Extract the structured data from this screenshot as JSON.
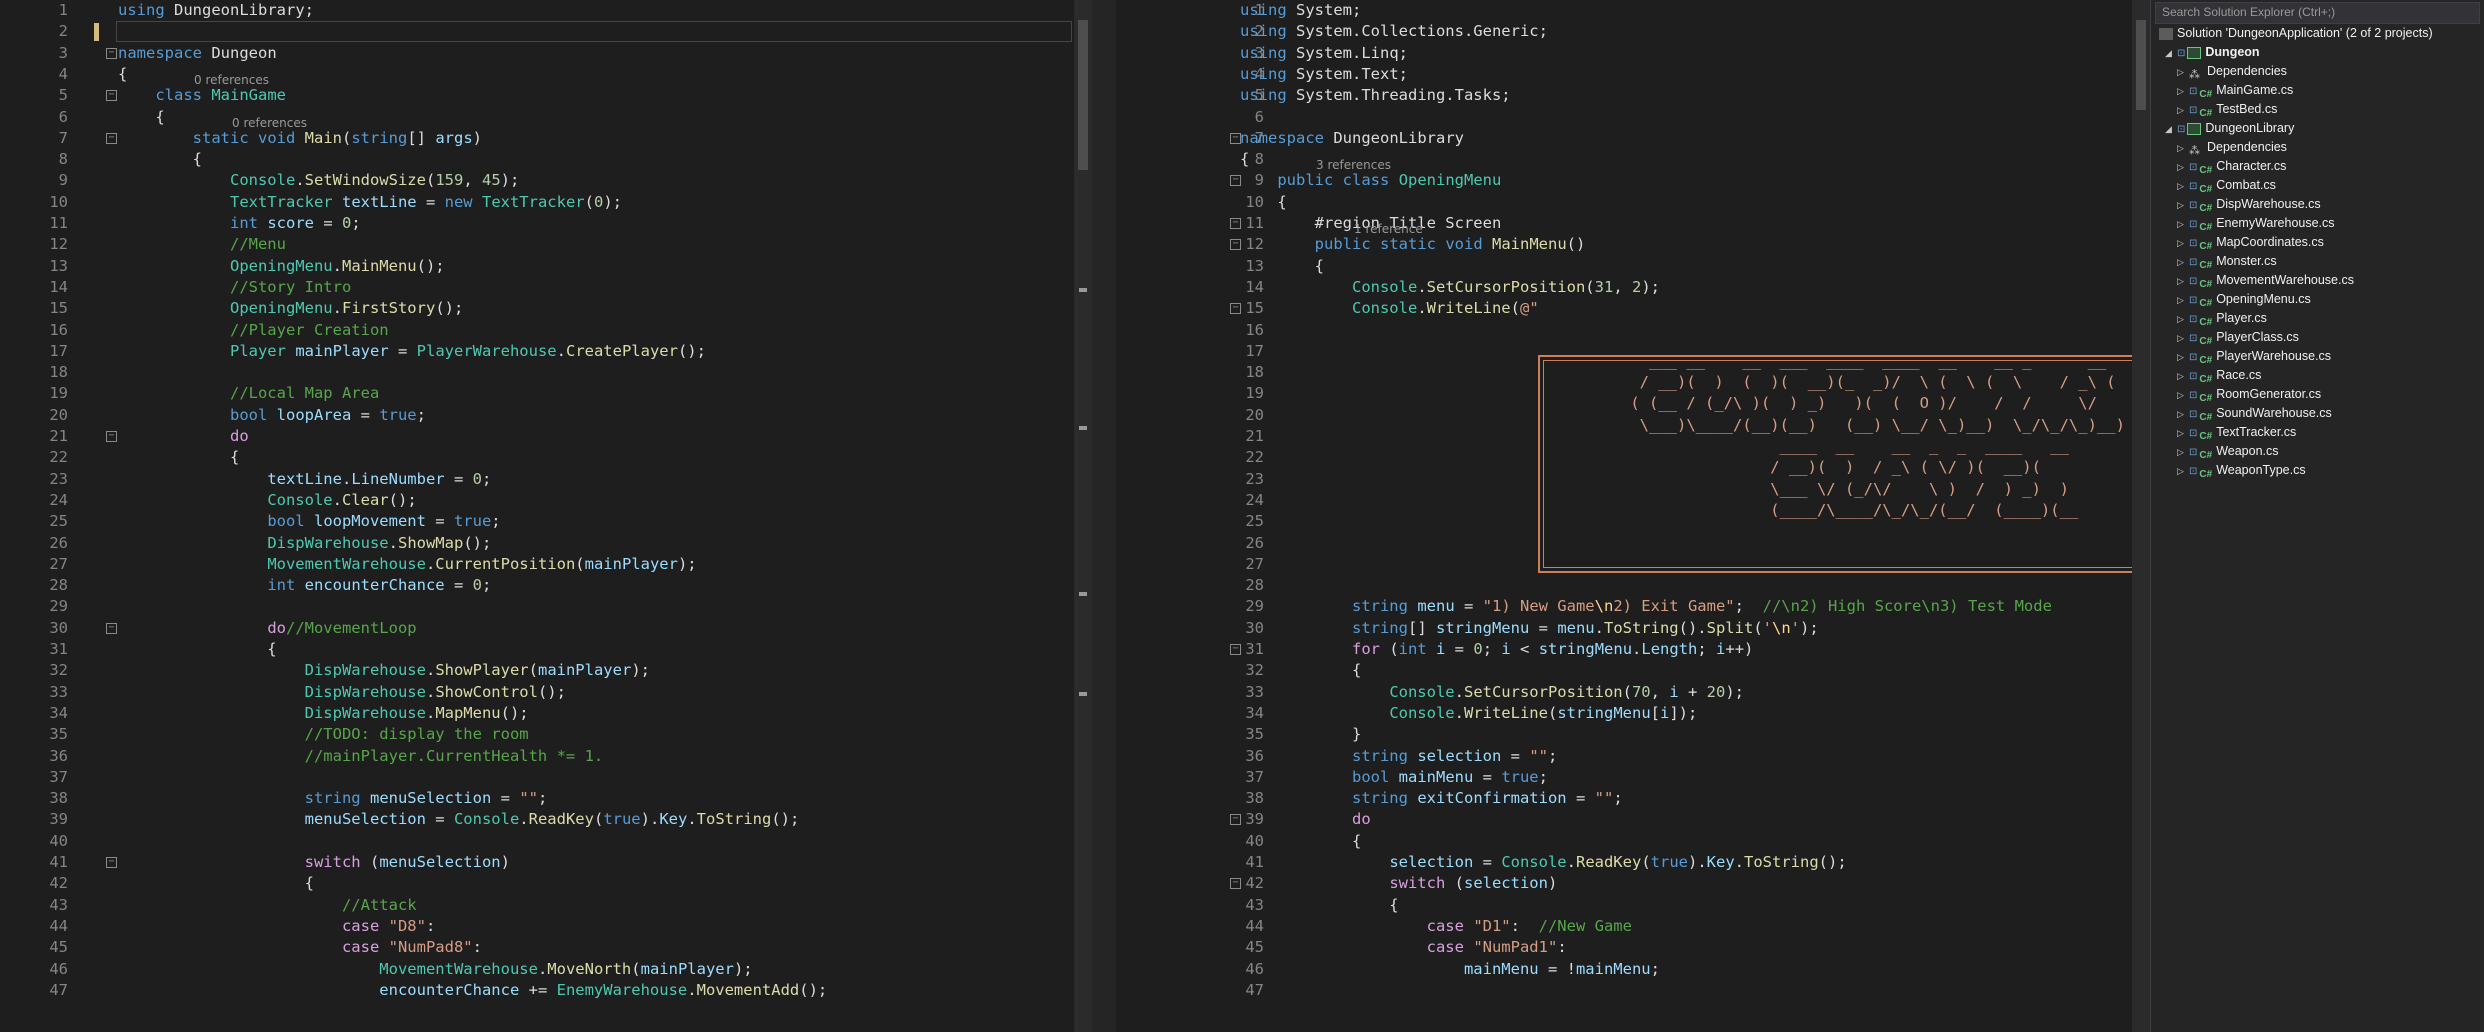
{
  "left_editor": {
    "lines": [
      {
        "n": 1,
        "html": "<span class=\"kw\">using</span> DungeonLibrary;"
      },
      {
        "n": 2,
        "html": ""
      },
      {
        "n": 3,
        "html": "<span class=\"kw\">namespace</span> Dungeon",
        "fold": true
      },
      {
        "n": 4,
        "html": "{"
      },
      {
        "n": 5,
        "html": "    <span class=\"kw\">class</span> <span class=\"ty\">MainGame</span>",
        "fold": true,
        "refs": "0 references"
      },
      {
        "n": 6,
        "html": "    {"
      },
      {
        "n": 7,
        "html": "        <span class=\"kw\">static</span> <span class=\"kw\">void</span> <span class=\"me\">Main</span>(<span class=\"kw\">string</span>[] <span class=\"va\">args</span>)",
        "fold": true,
        "refs": "0 references"
      },
      {
        "n": 8,
        "html": "        {"
      },
      {
        "n": 9,
        "html": "            <span class=\"ty\">Console</span>.<span class=\"me\">SetWindowSize</span>(<span class=\"nu\">159</span>, <span class=\"nu\">45</span>);"
      },
      {
        "n": 10,
        "html": "            <span class=\"ty\">TextTracker</span> <span class=\"va\">textLine</span> = <span class=\"kw\">new</span> <span class=\"ty\">TextTracker</span>(<span class=\"nu\">0</span>);"
      },
      {
        "n": 11,
        "html": "            <span class=\"kw\">int</span> <span class=\"va\">score</span> = <span class=\"nu\">0</span>;"
      },
      {
        "n": 12,
        "html": "            <span class=\"cm\">//Menu</span>"
      },
      {
        "n": 13,
        "html": "            <span class=\"ty\">OpeningMenu</span>.<span class=\"me\">MainMenu</span>();"
      },
      {
        "n": 14,
        "html": "            <span class=\"cm\">//Story Intro</span>"
      },
      {
        "n": 15,
        "html": "            <span class=\"ty\">OpeningMenu</span>.<span class=\"me\">FirstStory</span>();"
      },
      {
        "n": 16,
        "html": "            <span class=\"cm\">//Player Creation</span>"
      },
      {
        "n": 17,
        "html": "            <span class=\"ty\">Player</span> <span class=\"va\">mainPlayer</span> = <span class=\"ty\">PlayerWarehouse</span>.<span class=\"me\">CreatePlayer</span>();"
      },
      {
        "n": 18,
        "html": ""
      },
      {
        "n": 19,
        "html": "            <span class=\"cm\">//Local Map Area</span>"
      },
      {
        "n": 20,
        "html": "            <span class=\"kw\">bool</span> <span class=\"va\">loopArea</span> = <span class=\"kw\">true</span>;"
      },
      {
        "n": 21,
        "html": "            <span class=\"ctl\">do</span>",
        "fold": true
      },
      {
        "n": 22,
        "html": "            {"
      },
      {
        "n": 23,
        "html": "                <span class=\"va\">textLine</span>.<span class=\"va\">LineNumber</span> = <span class=\"nu\">0</span>;"
      },
      {
        "n": 24,
        "html": "                <span class=\"ty\">Console</span>.<span class=\"me\">Clear</span>();"
      },
      {
        "n": 25,
        "html": "                <span class=\"kw\">bool</span> <span class=\"va\">loopMovement</span> = <span class=\"kw\">true</span>;"
      },
      {
        "n": 26,
        "html": "                <span class=\"ty\">DispWarehouse</span>.<span class=\"me\">ShowMap</span>();"
      },
      {
        "n": 27,
        "html": "                <span class=\"ty\">MovementWarehouse</span>.<span class=\"me\">CurrentPosition</span>(<span class=\"va\">mainPlayer</span>);"
      },
      {
        "n": 28,
        "html": "                <span class=\"kw\">int</span> <span class=\"va\">encounterChance</span> = <span class=\"nu\">0</span>;"
      },
      {
        "n": 29,
        "html": ""
      },
      {
        "n": 30,
        "html": "                <span class=\"ctl\">do</span><span class=\"cm\">//MovementLoop</span>",
        "fold": true
      },
      {
        "n": 31,
        "html": "                {"
      },
      {
        "n": 32,
        "html": "                    <span class=\"ty\">DispWarehouse</span>.<span class=\"me\">ShowPlayer</span>(<span class=\"va\">mainPlayer</span>);"
      },
      {
        "n": 33,
        "html": "                    <span class=\"ty\">DispWarehouse</span>.<span class=\"me\">ShowControl</span>();"
      },
      {
        "n": 34,
        "html": "                    <span class=\"ty\">DispWarehouse</span>.<span class=\"me\">MapMenu</span>();"
      },
      {
        "n": 35,
        "html": "                    <span class=\"cm\">//TODO: display the room</span>"
      },
      {
        "n": 36,
        "html": "                    <span class=\"cm\">//mainPlayer.CurrentHealth *= 1.</span>"
      },
      {
        "n": 37,
        "html": ""
      },
      {
        "n": 38,
        "html": "                    <span class=\"kw\">string</span> <span class=\"va\">menuSelection</span> = <span class=\"st\">\"\"</span>;"
      },
      {
        "n": 39,
        "html": "                    <span class=\"va\">menuSelection</span> = <span class=\"ty\">Console</span>.<span class=\"me\">ReadKey</span>(<span class=\"kw\">true</span>).<span class=\"va\">Key</span>.<span class=\"me\">ToString</span>();"
      },
      {
        "n": 40,
        "html": ""
      },
      {
        "n": 41,
        "html": "                    <span class=\"ctl\">switch</span> (<span class=\"va\">menuSelection</span>)",
        "fold": true
      },
      {
        "n": 42,
        "html": "                    {"
      },
      {
        "n": 43,
        "html": "                        <span class=\"cm\">//Attack</span>"
      },
      {
        "n": 44,
        "html": "                        <span class=\"ctl\">case</span> <span class=\"st\">\"D8\"</span>:"
      },
      {
        "n": 45,
        "html": "                        <span class=\"ctl\">case</span> <span class=\"st\">\"NumPad8\"</span>:"
      },
      {
        "n": 46,
        "html": "                            <span class=\"ty\">MovementWarehouse</span>.<span class=\"me\">MoveNorth</span>(<span class=\"va\">mainPlayer</span>);"
      },
      {
        "n": 47,
        "html": "                            <span class=\"va\">encounterChance</span> += <span class=\"ty\">EnemyWarehouse</span>.<span class=\"me\">MovementAdd</span>();"
      }
    ]
  },
  "right_editor": {
    "lines": [
      {
        "n": 1,
        "html": "<span class=\"kw\">using</span> System;"
      },
      {
        "n": 2,
        "html": "<span class=\"kw\">using</span> System.Collections.Generic;"
      },
      {
        "n": 3,
        "html": "<span class=\"kw\">using</span> System.Linq;"
      },
      {
        "n": 4,
        "html": "<span class=\"kw\">using</span> System.Text;"
      },
      {
        "n": 5,
        "html": "<span class=\"kw\">using</span> System.Threading.Tasks;"
      },
      {
        "n": 6,
        "html": ""
      },
      {
        "n": 7,
        "html": "<span class=\"kw\">namespace</span> DungeonLibrary",
        "fold": true
      },
      {
        "n": 8,
        "html": "{"
      },
      {
        "n": 9,
        "html": "    <span class=\"kw\">public</span> <span class=\"kw\">class</span> <span class=\"ty\">OpeningMenu</span>",
        "fold": true,
        "refs": "3 references"
      },
      {
        "n": 10,
        "html": "    {"
      },
      {
        "n": 11,
        "html": "        <span class=\"rg\">#region</span> Title Screen",
        "fold": true
      },
      {
        "n": 12,
        "html": "        <span class=\"kw\">public</span> <span class=\"kw\">static</span> <span class=\"kw\">void</span> <span class=\"me\">MainMenu</span>()",
        "fold": true,
        "refs": "1 reference"
      },
      {
        "n": 13,
        "html": "        {"
      },
      {
        "n": 14,
        "html": "            <span class=\"ty\">Console</span>.<span class=\"me\">SetCursorPosition</span>(<span class=\"nu\">31</span>, <span class=\"nu\">2</span>);"
      },
      {
        "n": 15,
        "html": "            <span class=\"ty\">Console</span>.<span class=\"me\">WriteLine</span>(<span class=\"st\">@\"</span>",
        "fold": true
      },
      {
        "n": 16,
        "html": ""
      },
      {
        "n": 17,
        "html": ""
      },
      {
        "n": 18,
        "html": ""
      },
      {
        "n": 19,
        "html": ""
      },
      {
        "n": 20,
        "html": ""
      },
      {
        "n": 21,
        "html": ""
      },
      {
        "n": 22,
        "html": ""
      },
      {
        "n": 23,
        "html": ""
      },
      {
        "n": 24,
        "html": ""
      },
      {
        "n": 25,
        "html": ""
      },
      {
        "n": 26,
        "html": ""
      },
      {
        "n": 27,
        "html": ""
      },
      {
        "n": 28,
        "html": ""
      },
      {
        "n": 29,
        "html": "            <span class=\"kw\">string</span> <span class=\"va\">menu</span> = <span class=\"st\">\"1) New Game</span><span class=\"esc\">\\n</span><span class=\"st\">2) Exit Game\"</span>;  <span class=\"cm\">//\\n2) High Score\\n3) Test Mode</span>"
      },
      {
        "n": 30,
        "html": "            <span class=\"kw\">string</span>[] <span class=\"va\">stringMenu</span> = <span class=\"va\">menu</span>.<span class=\"me\">ToString</span>().<span class=\"me\">Split</span>(<span class=\"st\">'</span><span class=\"esc\">\\n</span><span class=\"st\">'</span>);"
      },
      {
        "n": 31,
        "html": "            <span class=\"ctl\">for</span> (<span class=\"kw\">int</span> <span class=\"va\">i</span> = <span class=\"nu\">0</span>; <span class=\"va\">i</span> &lt; <span class=\"va\">stringMenu</span>.<span class=\"va\">Length</span>; <span class=\"va\">i</span>++)",
        "fold": true
      },
      {
        "n": 32,
        "html": "            {"
      },
      {
        "n": 33,
        "html": "                <span class=\"ty\">Console</span>.<span class=\"me\">SetCursorPosition</span>(<span class=\"nu\">70</span>, <span class=\"va\">i</span> + <span class=\"nu\">20</span>);"
      },
      {
        "n": 34,
        "html": "                <span class=\"ty\">Console</span>.<span class=\"me\">WriteLine</span>(<span class=\"va\">stringMenu</span>[<span class=\"va\">i</span>]);"
      },
      {
        "n": 35,
        "html": "            }"
      },
      {
        "n": 36,
        "html": "            <span class=\"kw\">string</span> <span class=\"va\">selection</span> = <span class=\"st\">\"\"</span>;"
      },
      {
        "n": 37,
        "html": "            <span class=\"kw\">bool</span> <span class=\"va\">mainMenu</span> = <span class=\"kw\">true</span>;"
      },
      {
        "n": 38,
        "html": "            <span class=\"kw\">string</span> <span class=\"va\">exitConfirmation</span> = <span class=\"st\">\"\"</span>;"
      },
      {
        "n": 39,
        "html": "            <span class=\"ctl\">do</span>",
        "fold": true
      },
      {
        "n": 40,
        "html": "            {"
      },
      {
        "n": 41,
        "html": "                <span class=\"va\">selection</span> = <span class=\"ty\">Console</span>.<span class=\"me\">ReadKey</span>(<span class=\"kw\">true</span>).<span class=\"va\">Key</span>.<span class=\"me\">ToString</span>();"
      },
      {
        "n": 42,
        "html": "                <span class=\"ctl\">switch</span> (<span class=\"va\">selection</span>)",
        "fold": true
      },
      {
        "n": 43,
        "html": "                {"
      },
      {
        "n": 44,
        "html": "                    <span class=\"ctl\">case</span> <span class=\"st\">\"D1\"</span>:  <span class=\"cm\">//New Game</span>"
      },
      {
        "n": 45,
        "html": "                    <span class=\"ctl\">case</span> <span class=\"st\">\"NumPad1\"</span>:"
      },
      {
        "n": 46,
        "html": "                        <span class=\"va\">mainMenu</span> = !<span class=\"va\">mainMenu</span>;"
      },
      {
        "n": 47,
        "html": ""
      }
    ],
    "ascii_art": [
      "   ___ __    __  ___  ____  ____  __    __ _      __    __ _",
      "  / __)(  )  (  )(  __)(_  _)/  \\ (  \\ (  \\    / _\\ (  (",
      " ( (__ / (_/\\ )(  ) _)   )(  (  O )/    /  /     \\/",
      "  \\___)\\____/(__)(__)   (__) \\__/ \\_)__)  \\_/\\_/\\_)__)",
      "                 ____  __    __  _  _  ____   __",
      "                / __)(  )  / _\\ ( \\/ )(  __)(",
      "                \\___ \\/ (_/\\/    \\ )  /  ) _)  )",
      "                (____/\\____/\\_/\\_/(__/  (____)(__"
    ]
  },
  "solution_explorer": {
    "search_placeholder": "Search Solution Explorer (Ctrl+;)",
    "solution_label": "Solution 'DungeonApplication' (2 of 2 projects)",
    "items": [
      {
        "label": "Dungeon",
        "level": 1,
        "kind": "project",
        "expanded": true,
        "bold": true
      },
      {
        "label": "Dependencies",
        "level": 2,
        "kind": "deps"
      },
      {
        "label": "MainGame.cs",
        "level": 2,
        "kind": "cs"
      },
      {
        "label": "TestBed.cs",
        "level": 2,
        "kind": "cs"
      },
      {
        "label": "DungeonLibrary",
        "level": 1,
        "kind": "project",
        "expanded": true
      },
      {
        "label": "Dependencies",
        "level": 2,
        "kind": "deps"
      },
      {
        "label": "Character.cs",
        "level": 2,
        "kind": "cs"
      },
      {
        "label": "Combat.cs",
        "level": 2,
        "kind": "cs"
      },
      {
        "label": "DispWarehouse.cs",
        "level": 2,
        "kind": "cs"
      },
      {
        "label": "EnemyWarehouse.cs",
        "level": 2,
        "kind": "cs"
      },
      {
        "label": "MapCoordinates.cs",
        "level": 2,
        "kind": "cs"
      },
      {
        "label": "Monster.cs",
        "level": 2,
        "kind": "cs"
      },
      {
        "label": "MovementWarehouse.cs",
        "level": 2,
        "kind": "cs"
      },
      {
        "label": "OpeningMenu.cs",
        "level": 2,
        "kind": "cs"
      },
      {
        "label": "Player.cs",
        "level": 2,
        "kind": "cs"
      },
      {
        "label": "PlayerClass.cs",
        "level": 2,
        "kind": "cs"
      },
      {
        "label": "PlayerWarehouse.cs",
        "level": 2,
        "kind": "cs"
      },
      {
        "label": "Race.cs",
        "level": 2,
        "kind": "cs"
      },
      {
        "label": "RoomGenerator.cs",
        "level": 2,
        "kind": "cs"
      },
      {
        "label": "SoundWarehouse.cs",
        "level": 2,
        "kind": "cs"
      },
      {
        "label": "TextTracker.cs",
        "level": 2,
        "kind": "cs"
      },
      {
        "label": "Weapon.cs",
        "level": 2,
        "kind": "cs"
      },
      {
        "label": "WeaponType.cs",
        "level": 2,
        "kind": "cs"
      }
    ]
  },
  "colors": {
    "editor_bg": "#1e1e1e",
    "keyword": "#569cd6",
    "type": "#4ec9b0",
    "method": "#dcdcaa",
    "string": "#d69d85",
    "comment": "#57a64a",
    "line_number": "#858585"
  }
}
